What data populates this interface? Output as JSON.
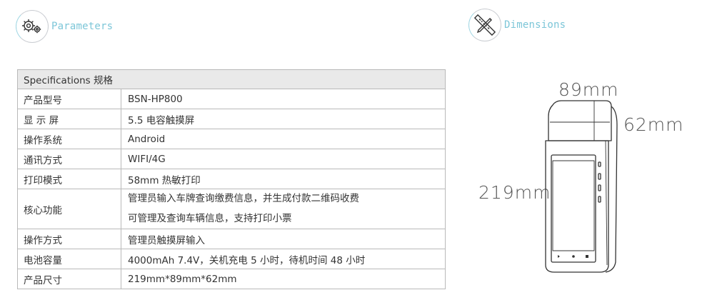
{
  "parameters_section": {
    "title": "Parameters",
    "icon": "gears-icon"
  },
  "dimensions_section": {
    "title": "Dimensions",
    "icon": "ruler-pencil-icon"
  },
  "spec_table": {
    "header": "Specifications 规格",
    "rows": [
      {
        "key": "产品型号",
        "value": "BSN-HP800"
      },
      {
        "key": "显 示 屏",
        "value": "5.5 电容触摸屏"
      },
      {
        "key": "操作系统",
        "value": "Android"
      },
      {
        "key": "通讯方式",
        "value": "WIFI/4G"
      },
      {
        "key": "打印模式",
        "value": "58mm 热敏打印"
      },
      {
        "key": "核心功能",
        "lines": [
          "管理员输入车牌查询缴费信息，并生成付款二维码收费",
          "可管理及查询车辆信息，支持打印小票"
        ]
      },
      {
        "key": "操作方式",
        "value": "管理员触摸屏输入"
      },
      {
        "key": "电池容量",
        "value": "4000mAh 7.4V，关机充电 5 小时，待机时间 48 小时"
      },
      {
        "key": "产品尺寸",
        "value": "219mm*89mm*62mm"
      }
    ]
  },
  "dimensions": {
    "width": "89mm",
    "depth": "62mm",
    "height": "219mm"
  },
  "colors": {
    "accent": "#7cc6d8",
    "header_bg": "#e9e9e9",
    "border": "#b9b9b9"
  }
}
